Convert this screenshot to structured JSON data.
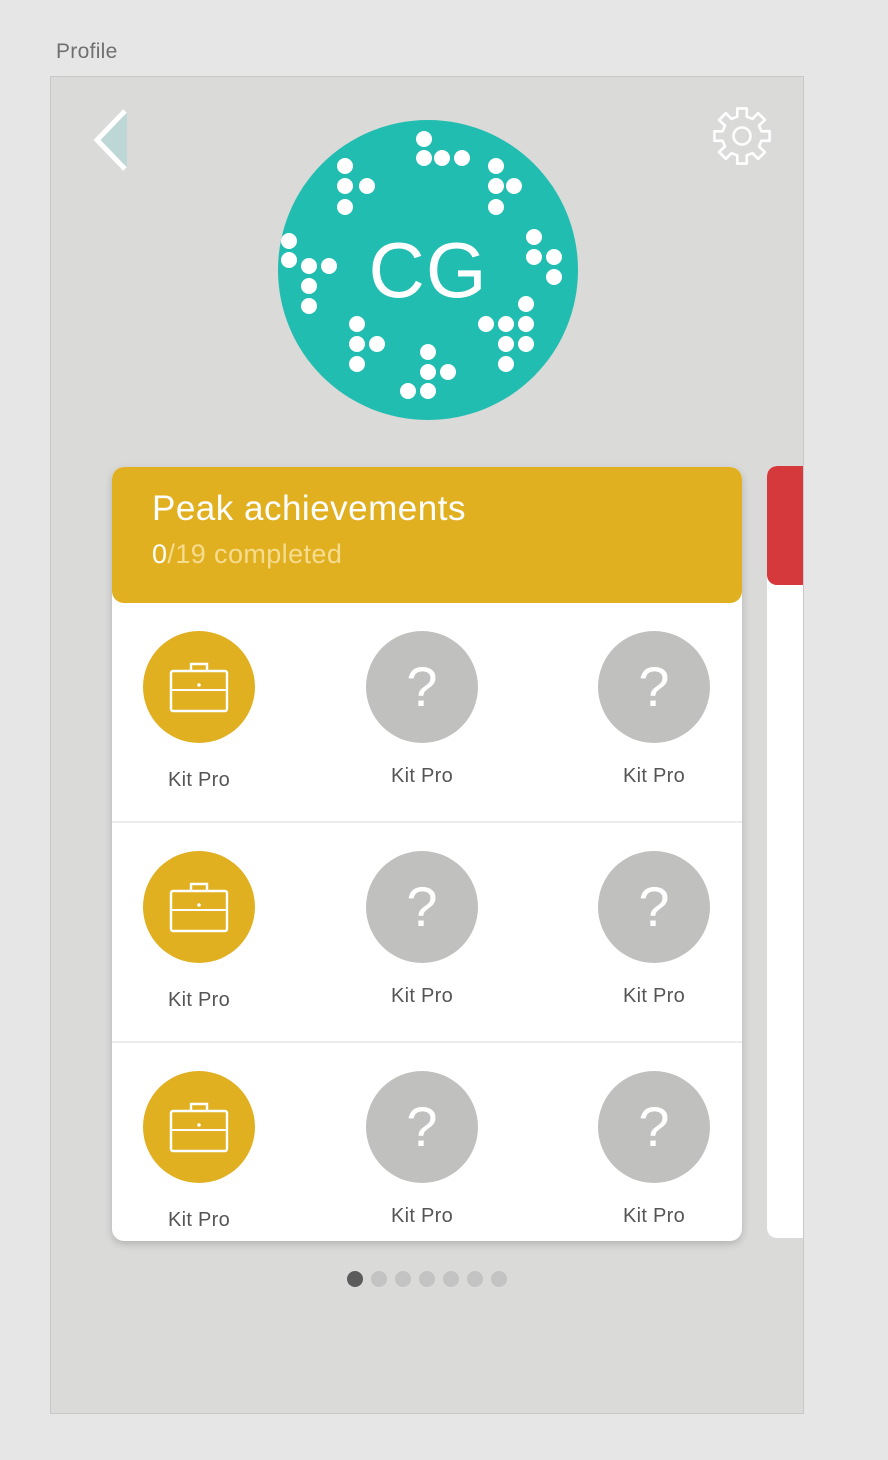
{
  "artboard": {
    "label": "Profile"
  },
  "avatar": {
    "initials": "CG",
    "color": "#21bdb0"
  },
  "card": {
    "title": "Peak achievements",
    "completed": "0",
    "total_text": "/19 completed",
    "header_color": "#e1b020",
    "badges": [
      [
        {
          "label": "Kit Pro",
          "state": "earned",
          "icon": "briefcase-icon"
        },
        {
          "label": "Kit Pro",
          "state": "locked",
          "icon": "question-mark-icon",
          "symbol": "?"
        },
        {
          "label": "Kit Pro",
          "state": "locked",
          "icon": "question-mark-icon",
          "symbol": "?"
        }
      ],
      [
        {
          "label": "Kit Pro",
          "state": "earned",
          "icon": "briefcase-icon"
        },
        {
          "label": "Kit Pro",
          "state": "locked",
          "icon": "question-mark-icon",
          "symbol": "?"
        },
        {
          "label": "Kit Pro",
          "state": "locked",
          "icon": "question-mark-icon",
          "symbol": "?"
        }
      ],
      [
        {
          "label": "Kit Pro",
          "state": "earned",
          "icon": "briefcase-icon"
        },
        {
          "label": "Kit Pro",
          "state": "locked",
          "icon": "question-mark-icon",
          "symbol": "?"
        },
        {
          "label": "Kit Pro",
          "state": "locked",
          "icon": "question-mark-icon",
          "symbol": "?"
        }
      ]
    ]
  },
  "next_card": {
    "header_color": "#d5393b"
  },
  "pager": {
    "pages": 7,
    "active": 1
  },
  "icons": {
    "back": "chevron-left-icon",
    "settings": "gear-icon"
  }
}
